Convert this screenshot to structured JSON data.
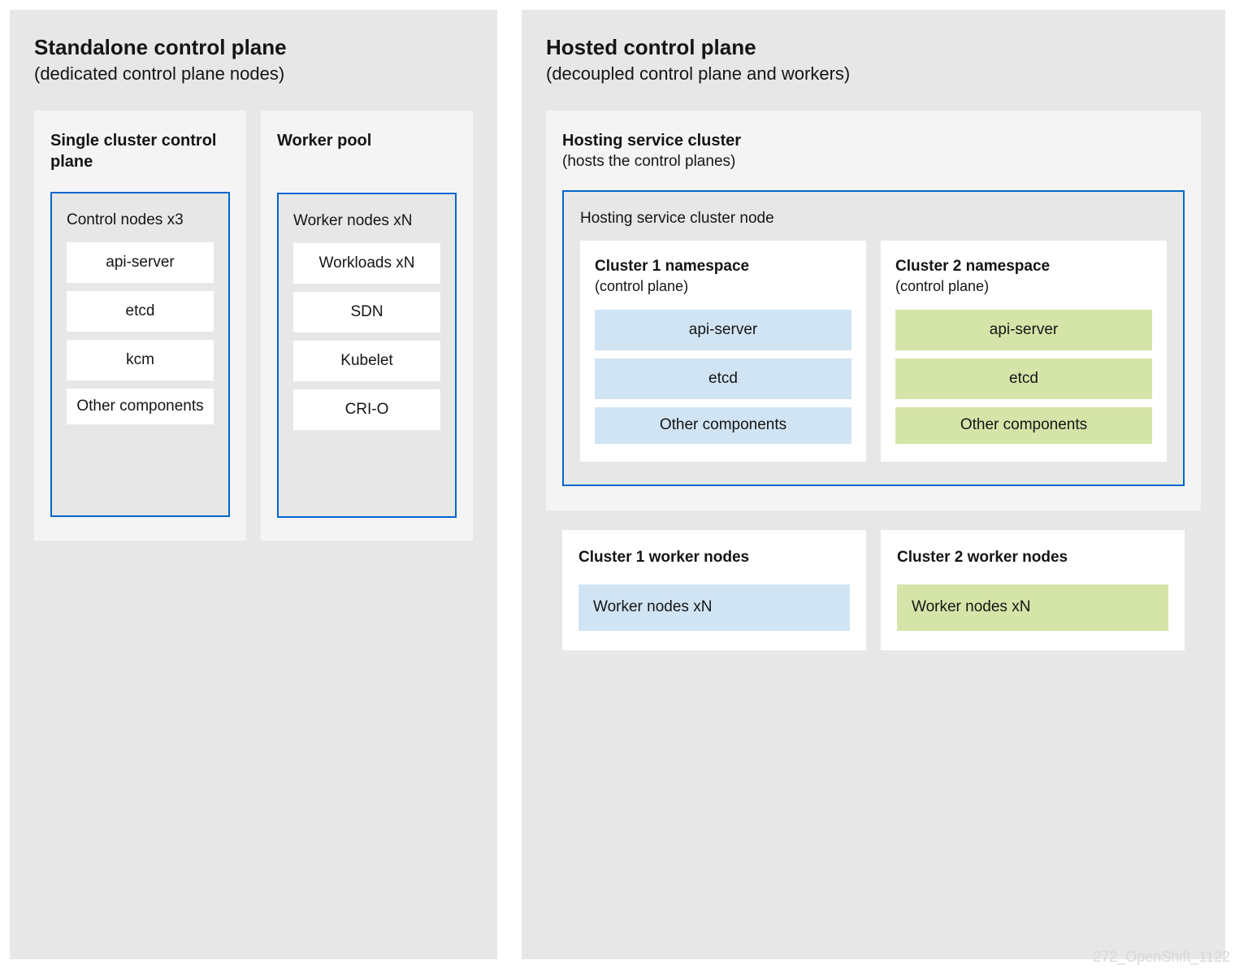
{
  "left": {
    "title": "Standalone control plane",
    "subtitle": "(dedicated control plane nodes)",
    "singleCluster": {
      "title": "Single cluster control plane",
      "nodeLabel": "Control nodes  x3",
      "components": [
        "api-server",
        "etcd",
        "kcm"
      ],
      "otherLabel": "Other components"
    },
    "workerPool": {
      "title": "Worker pool",
      "nodeLabel": "Worker nodes  xN",
      "components": [
        "Workloads  xN",
        "SDN",
        "Kubelet",
        "CRI-O"
      ]
    }
  },
  "right": {
    "title": "Hosted control plane",
    "subtitle": "(decoupled control plane and workers)",
    "hosting": {
      "title": "Hosting service cluster",
      "subtitle": "(hosts the control planes)",
      "nodeLabel": "Hosting service cluster node",
      "cluster1": {
        "title": "Cluster 1 namespace",
        "subtitle": "(control plane)",
        "components": [
          "api-server",
          "etcd"
        ],
        "otherLabel": "Other components"
      },
      "cluster2": {
        "title": "Cluster 2 namespace",
        "subtitle": "(control plane)",
        "components": [
          "api-server",
          "etcd"
        ],
        "otherLabel": "Other components"
      }
    },
    "workers": {
      "cluster1": {
        "title": "Cluster 1 worker nodes",
        "nodeLabel": "Worker nodes  xN"
      },
      "cluster2": {
        "title": "Cluster 2 worker nodes",
        "nodeLabel": "Worker nodes  xN"
      }
    }
  },
  "watermark": "272_OpenShift_1122"
}
